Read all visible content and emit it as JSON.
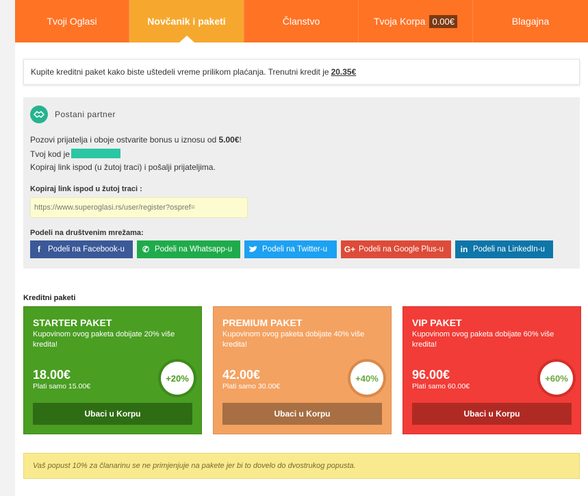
{
  "nav": {
    "tabs": [
      {
        "label": "Tvoji Oglasi"
      },
      {
        "label": "Novčanik i paketi"
      },
      {
        "label": "Članstvo"
      },
      {
        "label": "Tvoja Korpa"
      },
      {
        "label": "Blagajna"
      }
    ],
    "cart_amount": "0.00€"
  },
  "info": {
    "text": "Kupite kreditni paket kako biste uštedeli vreme prilikom plaćanja. Trenutni kredit je",
    "credit": "20.35€"
  },
  "partner": {
    "icon": "handshake-icon",
    "title": "Postani partner",
    "line1_pre": "Pozovi prijatelja i oboje ostvarite bonus u iznosu od ",
    "bonus": "5.00€",
    "line1_post": "!",
    "code_label": "Tvoj kod je",
    "line3": "Kopiraj link ispod (u žutoj traci) i pošalji prijateljima.",
    "copy_label": "Kopiraj link ispod u žutoj traci :",
    "link_value": "https://www.superoglasi.rs/user/register?ospref=",
    "share_label": "Podeli na društvenim mrežama:",
    "share": [
      {
        "label": "Podeli na Facebook-u",
        "icon": "facebook-icon",
        "glyph": "f"
      },
      {
        "label": "Podeli na Whatsapp-u",
        "icon": "whatsapp-icon",
        "glyph": "✆"
      },
      {
        "label": "Podeli na Twitter-u",
        "icon": "twitter-icon",
        "glyph": "🐦"
      },
      {
        "label": "Podeli na Google Plus-u",
        "icon": "google-plus-icon",
        "glyph": "G+"
      },
      {
        "label": "Podeli na LinkedIn-u",
        "icon": "linkedin-icon",
        "glyph": "in"
      }
    ]
  },
  "packages": {
    "heading": "Kreditni paketi",
    "items": [
      {
        "name": "STARTER PAKET",
        "desc": "Kupovinom ovog paketa dobijate 20% više kredita!",
        "price": "18.00€",
        "pay": "Plati samo 15.00€",
        "bonus": "+20%",
        "button": "Ubaci u Korpu",
        "color": "#4a9e22"
      },
      {
        "name": "PREMIUM PAKET",
        "desc": "Kupovinom ovog paketa dobijate 40% više kredita!",
        "price": "42.00€",
        "pay": "Plati samo 30.00€",
        "bonus": "+40%",
        "button": "Ubaci u Korpu",
        "color": "#f4a261"
      },
      {
        "name": "VIP PAKET",
        "desc": "Kupovinom ovog paketa dobijate 60% više kredita!",
        "price": "96.00€",
        "pay": "Plati samo 60.00€",
        "bonus": "+60%",
        "button": "Ubaci u Korpu",
        "color": "#f23c37"
      }
    ]
  },
  "notice": "Vaš popust 10% za članarinu se ne primjenjuje na pakete jer bi to dovelo do dvostrukog popusta.",
  "colors": {
    "nav_bg": "#ff7325",
    "nav_active": "#f6a82e",
    "notice_bg": "#f9ea8f"
  }
}
